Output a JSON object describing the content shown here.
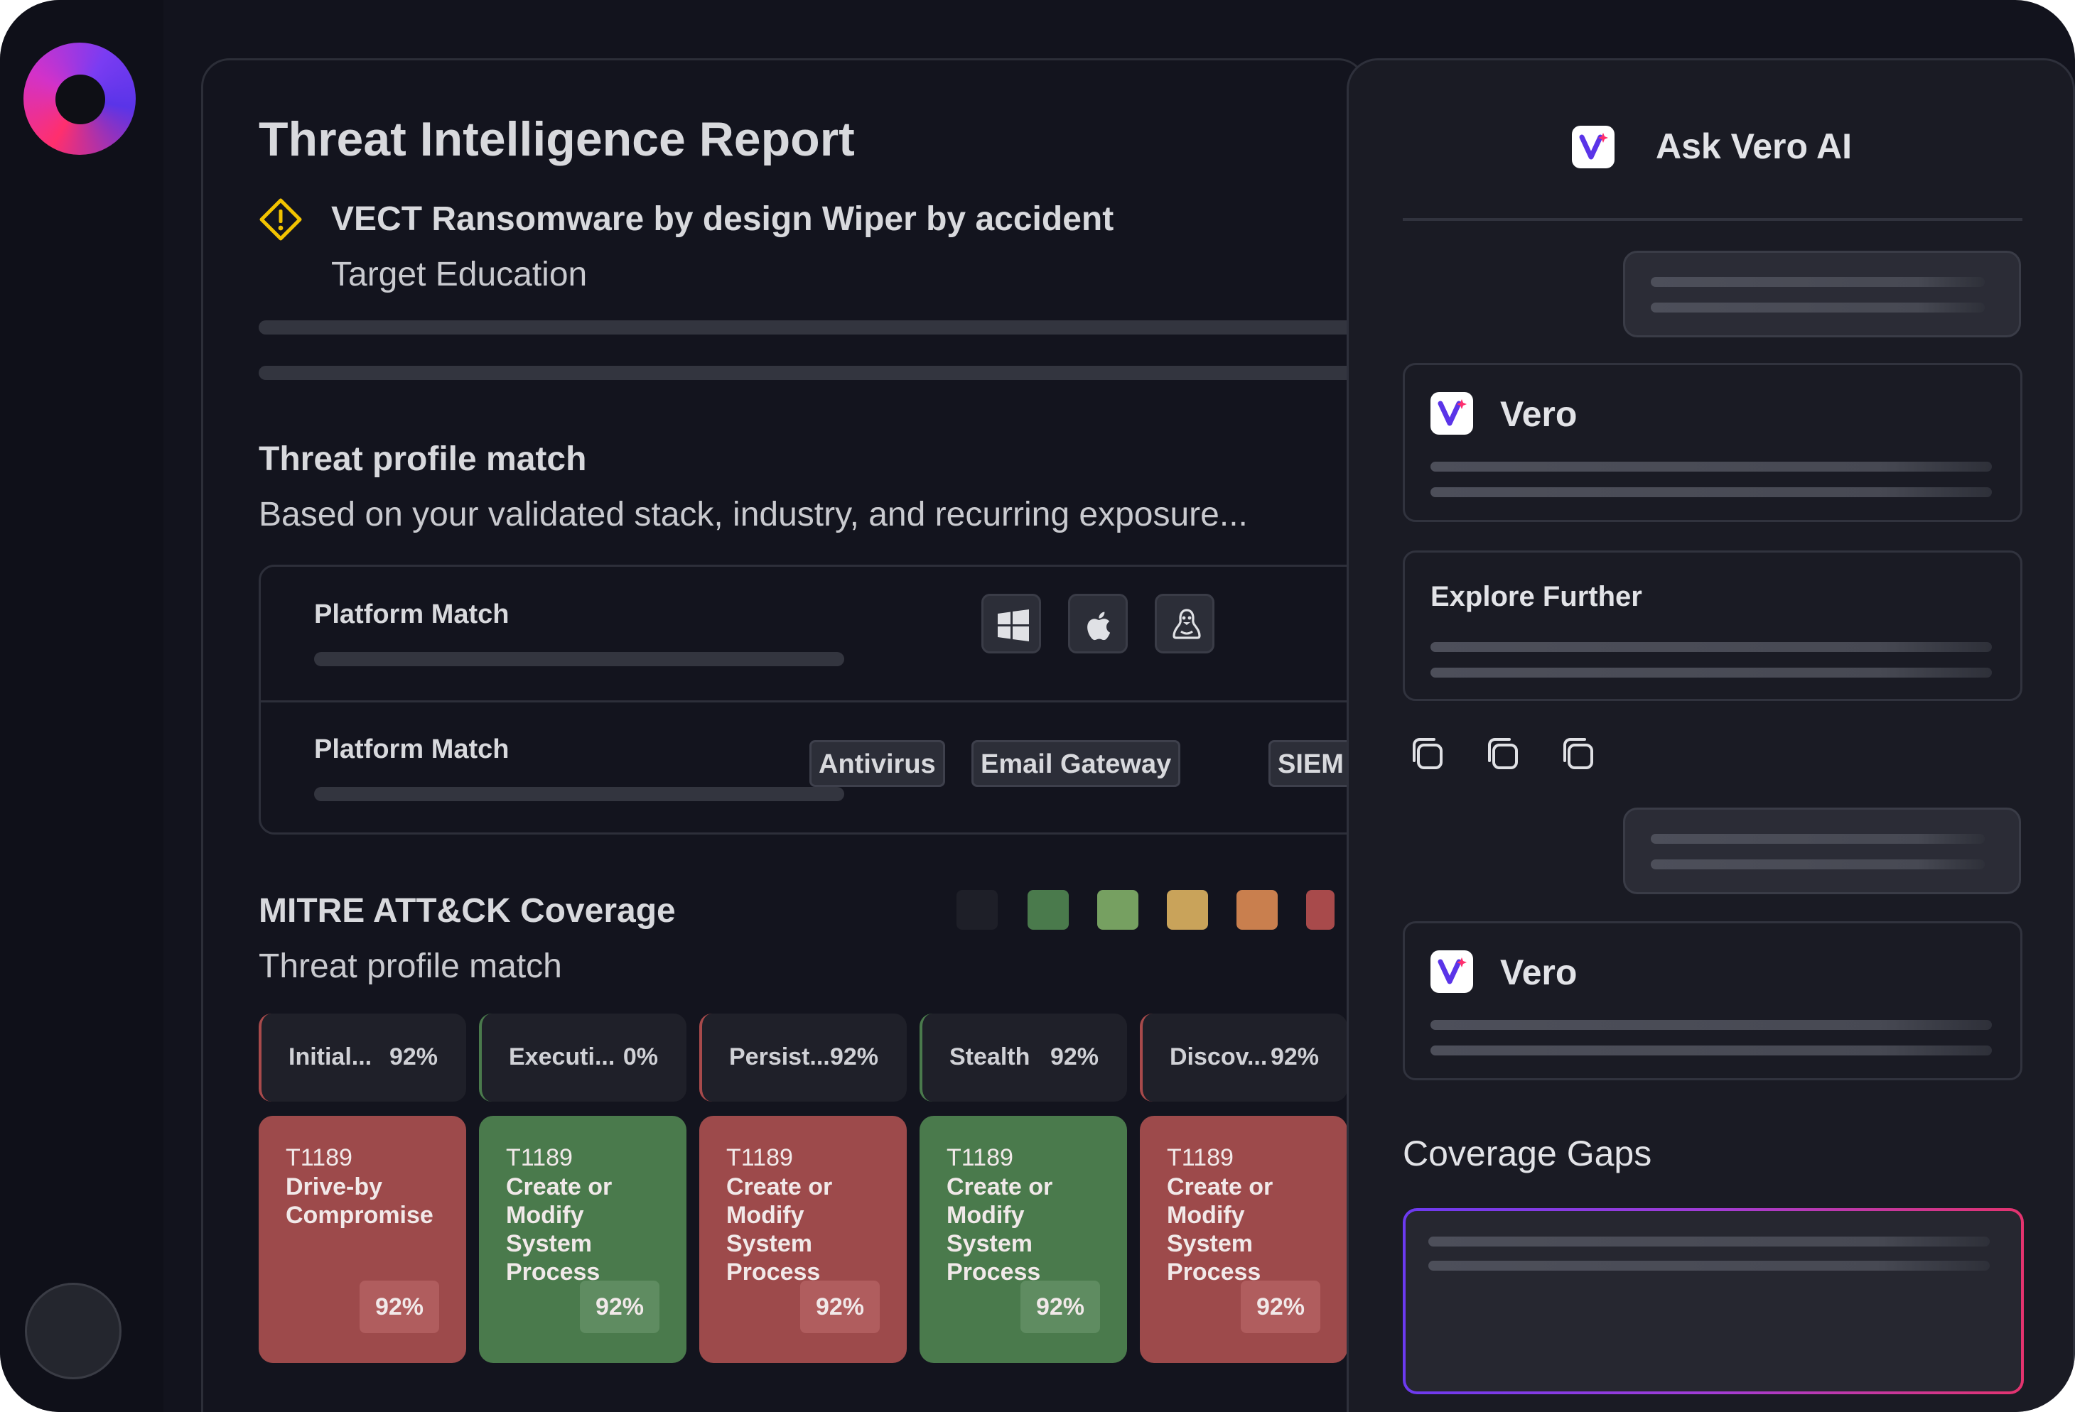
{
  "report": {
    "title": "Threat Intelligence Report",
    "subtitle": "VECT Ransomware by design Wiper by accident",
    "target": "Target Education"
  },
  "profile": {
    "title": "Threat profile match",
    "description": "Based on your validated stack, industry, and recurring exposure..."
  },
  "platform": {
    "row1_label": "Platform Match",
    "row2_label": "Platform Match",
    "os_icons": [
      "windows-icon",
      "apple-icon",
      "linux-icon"
    ],
    "tags": [
      "Antivirus",
      "Email Gateway",
      "SIEM"
    ]
  },
  "mitre": {
    "title": "MITRE ATT&CK Coverage",
    "subtitle": "Threat profile match",
    "legend_colors": [
      "#1e1f28",
      "#4a7a4c",
      "#76a061",
      "#c9a35a",
      "#c97f4e",
      "#a84a4b"
    ],
    "tactics": [
      {
        "name": "Initial...",
        "pct": "92%",
        "accent": "#a84a4b"
      },
      {
        "name": "Executi...",
        "pct": "0%",
        "accent": "#4a7a4c"
      },
      {
        "name": "Persist...",
        "pct": "92%",
        "accent": "#a84a4b"
      },
      {
        "name": "Stealth",
        "pct": "92%",
        "accent": "#4a7a4c"
      },
      {
        "name": "Discov...",
        "pct": "92%",
        "accent": "#a84a4b"
      }
    ],
    "techniques": [
      {
        "id": "T1189",
        "name": "Drive-by Compromise",
        "pct": "92%",
        "status": "red"
      },
      {
        "id": "T1189",
        "name": "Create or Modify System Process",
        "pct": "92%",
        "status": "green"
      },
      {
        "id": "T1189",
        "name": "Create or Modify System Process",
        "pct": "92%",
        "status": "red"
      },
      {
        "id": "T1189",
        "name": "Create or Modify System Process",
        "pct": "92%",
        "status": "green"
      },
      {
        "id": "T1189",
        "name": "Create or Modify System Process",
        "pct": "92%",
        "status": "red"
      }
    ]
  },
  "chat": {
    "title": "Ask Vero AI",
    "vero_label_1": "Vero",
    "explore_label": "Explore Further",
    "vero_label_2": "Vero",
    "copy_icons": [
      "copy-icon",
      "copy-icon",
      "copy-icon"
    ],
    "gaps_title": "Coverage Gaps"
  },
  "colors": {
    "background": "#12131d",
    "panel": "#13141e",
    "chat_panel": "#1a1b24",
    "warning": "#f2c300",
    "red": "#9d4a4b",
    "green": "#4a7a4c",
    "brand_purple": "#6c3af0",
    "brand_pink": "#e4336e"
  }
}
